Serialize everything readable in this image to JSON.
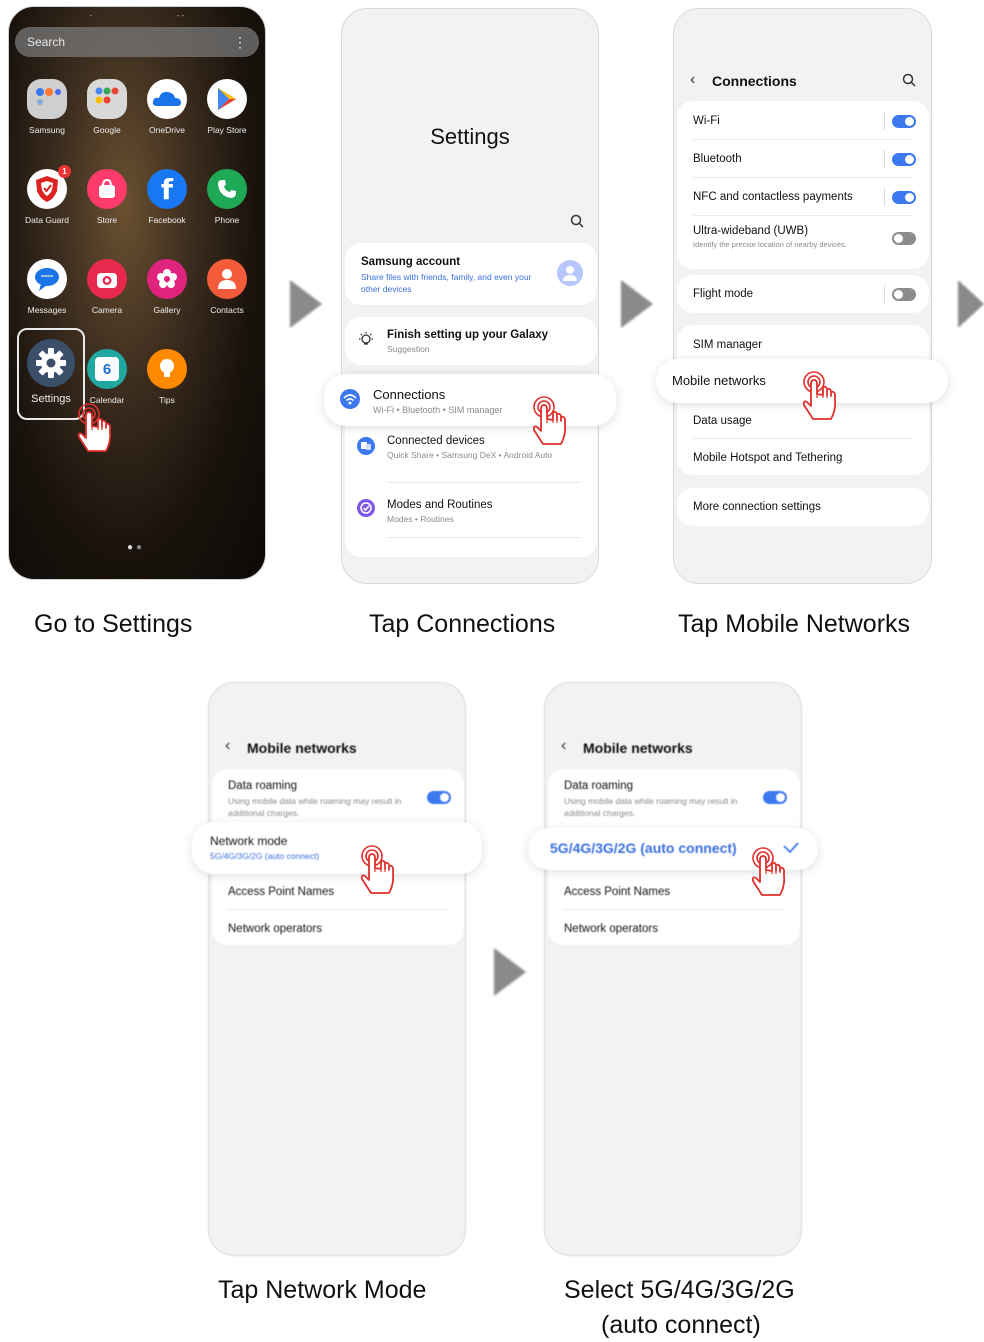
{
  "home": {
    "search_placeholder": "Search",
    "apps": [
      {
        "label": "Samsung"
      },
      {
        "label": "Google"
      },
      {
        "label": "OneDrive"
      },
      {
        "label": "Play Store"
      },
      {
        "label": "Data Guard",
        "badge": "1"
      },
      {
        "label": "Store"
      },
      {
        "label": "Facebook"
      },
      {
        "label": "Phone"
      },
      {
        "label": "Messages"
      },
      {
        "label": "Camera"
      },
      {
        "label": "Gallery"
      },
      {
        "label": "Contacts"
      },
      {
        "label": "Settings"
      },
      {
        "label": "Calendar",
        "day": "6"
      },
      {
        "label": "Tips"
      }
    ]
  },
  "settings": {
    "title": "Settings",
    "account_title": "Samsung account",
    "account_sub": "Share files with friends, family, and even your other devices",
    "finish_title": "Finish setting up your Galaxy",
    "finish_sub": "Suggestion",
    "connections_title": "Connections",
    "connections_sub": "Wi-Fi  •  Bluetooth  •  SIM manager",
    "devices_title": "Connected devices",
    "devices_sub": "Quick Share  •  Samsung DeX  •  Android Auto",
    "modes_title": "Modes and Routines",
    "modes_sub": "Modes  •  Routines"
  },
  "connections": {
    "title": "Connections",
    "wifi": "Wi-Fi",
    "bluetooth": "Bluetooth",
    "nfc": "NFC and contactless payments",
    "uwb_title": "Ultra-wideband (UWB)",
    "uwb_sub": "Identify the precise location of nearby devices.",
    "flight": "Flight mode",
    "sim": "SIM manager",
    "mobile": "Mobile networks",
    "data_usage": "Data usage",
    "hotspot": "Mobile Hotspot and Tethering",
    "more": "More connection settings"
  },
  "mobile": {
    "title": "Mobile networks",
    "roaming_title": "Data roaming",
    "roaming_sub": "Using mobile data while roaming may result in additional charges.",
    "mode_title": "Network mode",
    "mode_value": "5G/4G/3G/2G (auto connect)",
    "apn": "Access Point Names",
    "operators": "Network operators"
  },
  "captions": {
    "step1": "Go to Settings",
    "step2": "Tap Connections",
    "step3": "Tap Mobile Networks",
    "step4": "Tap Network Mode",
    "step5_line1": "Select 5G/4G/3G/2G",
    "step5_line2": "(auto connect)"
  },
  "colors": {
    "accent": "#3c78f0",
    "link": "#3a6fe0",
    "tap": "#e0302c"
  }
}
